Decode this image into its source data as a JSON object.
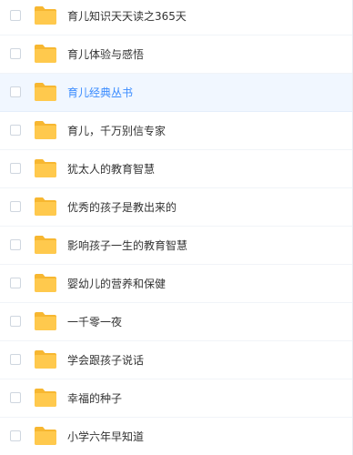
{
  "file_list": {
    "items": [
      {
        "name": "育儿知识天天读之365天",
        "icon": "folder-icon",
        "highlighted": false
      },
      {
        "name": "育儿体验与感悟",
        "icon": "folder-icon",
        "highlighted": false
      },
      {
        "name": "育儿经典丛书",
        "icon": "folder-icon",
        "highlighted": true
      },
      {
        "name": "育儿，千万别信专家",
        "icon": "folder-icon",
        "highlighted": false
      },
      {
        "name": "犹太人的教育智慧",
        "icon": "folder-icon",
        "highlighted": false
      },
      {
        "name": "优秀的孩子是教出来的",
        "icon": "folder-icon",
        "highlighted": false
      },
      {
        "name": "影响孩子一生的教育智慧",
        "icon": "folder-icon",
        "highlighted": false
      },
      {
        "name": "婴幼儿的营养和保健",
        "icon": "folder-icon",
        "highlighted": false
      },
      {
        "name": "一千零一夜",
        "icon": "folder-icon",
        "highlighted": false
      },
      {
        "name": "学会跟孩子说话",
        "icon": "folder-icon",
        "highlighted": false
      },
      {
        "name": "幸福的种子",
        "icon": "folder-icon",
        "highlighted": false
      },
      {
        "name": "小学六年早知道",
        "icon": "folder-icon",
        "highlighted": false
      }
    ],
    "colors": {
      "folder": "#ffc94d",
      "folder_tab": "#f7b731",
      "highlight_bg": "#f1f7ff",
      "highlight_text": "#3b8cff"
    }
  }
}
